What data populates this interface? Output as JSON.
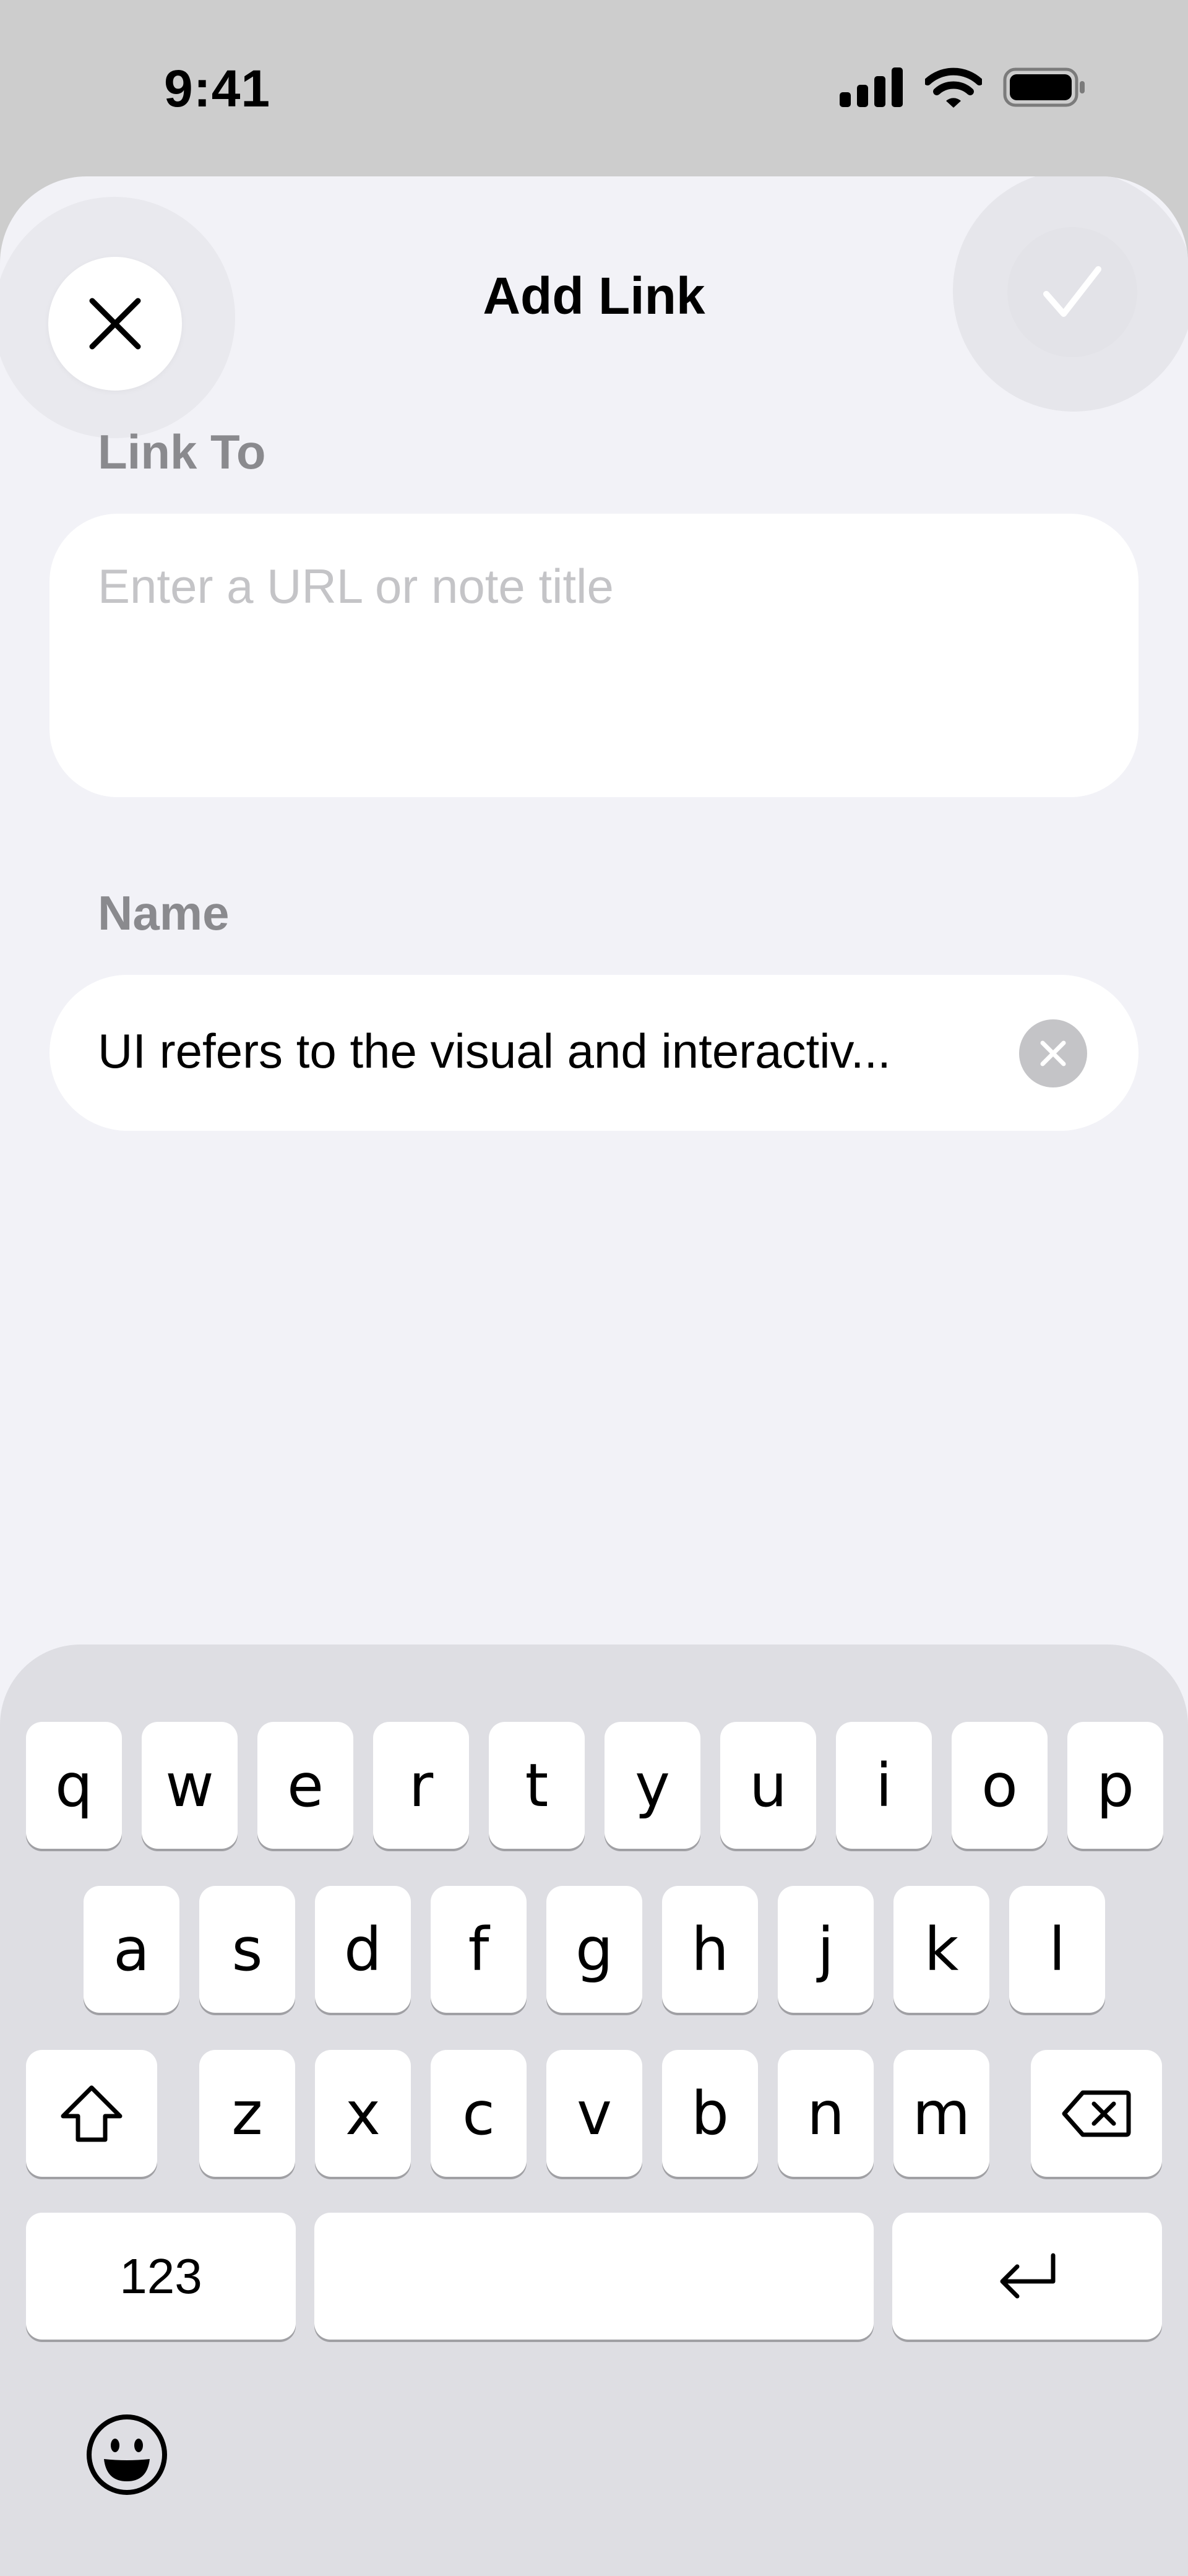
{
  "status_bar": {
    "time": "9:41"
  },
  "nav": {
    "title": "Add Link"
  },
  "link_to": {
    "label": "Link To",
    "placeholder": "Enter a URL or note title",
    "value": ""
  },
  "name": {
    "label": "Name",
    "value": "UI refers to the visual and interactiv..."
  },
  "keyboard": {
    "row1": [
      "q",
      "w",
      "e",
      "r",
      "t",
      "y",
      "u",
      "i",
      "o",
      "p"
    ],
    "row2": [
      "a",
      "s",
      "d",
      "f",
      "g",
      "h",
      "j",
      "k",
      "l"
    ],
    "row3": [
      "z",
      "x",
      "c",
      "v",
      "b",
      "n",
      "m"
    ],
    "numbers_label": "123",
    "icons": {
      "shift": "shift-icon",
      "delete": "delete-backspace-icon",
      "return": "return-icon",
      "emoji": "emoji-icon"
    }
  },
  "colors": {
    "sheet": "#F2F2F7",
    "keyboard": "#DEDEE3",
    "secondary_label": "#8A8A8E"
  }
}
